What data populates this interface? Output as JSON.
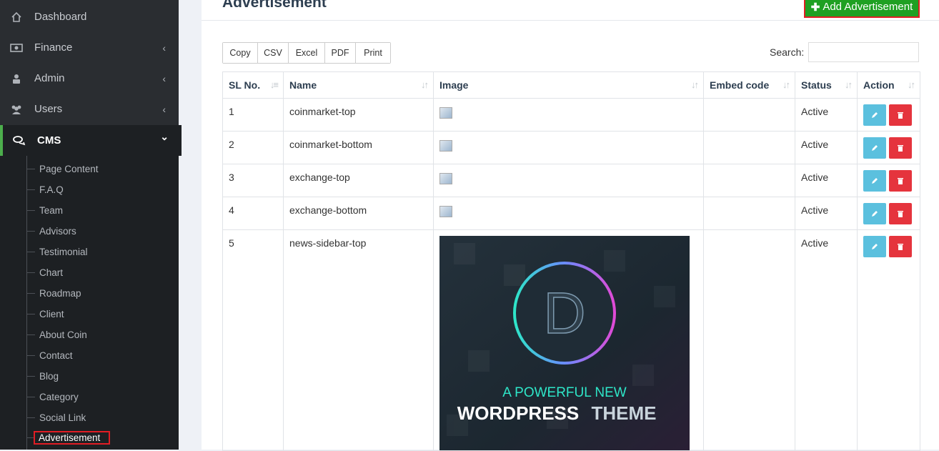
{
  "sidebar": {
    "items": [
      {
        "label": "Dashboard",
        "icon": "home-icon",
        "chevron": ""
      },
      {
        "label": "Finance",
        "icon": "money-icon",
        "chevron": "‹"
      },
      {
        "label": "Admin",
        "icon": "admin-icon",
        "chevron": "‹"
      },
      {
        "label": "Users",
        "icon": "users-icon",
        "chevron": "‹"
      },
      {
        "label": "CMS",
        "icon": "comments-icon",
        "chevron": "⌄"
      }
    ],
    "sub_items": [
      "Page Content",
      "F.A.Q",
      "Team",
      "Advisors",
      "Testimonial",
      "Chart",
      "Roadmap",
      "Client",
      "About Coin",
      "Contact",
      "Blog",
      "Category",
      "Social Link",
      "Advertisement"
    ]
  },
  "header": {
    "title": "Advertisement",
    "add_button": "Add Advertisement"
  },
  "export_buttons": [
    "Copy",
    "CSV",
    "Excel",
    "PDF",
    "Print"
  ],
  "search": {
    "label": "Search:",
    "value": ""
  },
  "table": {
    "headers": [
      "SL No.",
      "Name",
      "Image",
      "Embed code",
      "Status",
      "Action"
    ],
    "rows": [
      {
        "sl": "1",
        "name": "coinmarket-top",
        "embed": "",
        "status": "Active"
      },
      {
        "sl": "2",
        "name": "coinmarket-bottom",
        "embed": "",
        "status": "Active"
      },
      {
        "sl": "3",
        "name": "exchange-top",
        "embed": "",
        "status": "Active"
      },
      {
        "sl": "4",
        "name": "exchange-bottom",
        "embed": "",
        "status": "Active"
      },
      {
        "sl": "5",
        "name": "news-sidebar-top",
        "embed": "",
        "status": "Active"
      }
    ]
  },
  "banner": {
    "letter": "D",
    "line1": "A POWERFUL NEW",
    "line2a": "WORDPRESS",
    "line2b": "THEME"
  },
  "colors": {
    "sidebar_bg": "#2a2d31",
    "accent_green": "#1fa022",
    "highlight_red": "#e11d24",
    "edit_btn": "#5bc0de",
    "delete_btn": "#e5343d"
  }
}
